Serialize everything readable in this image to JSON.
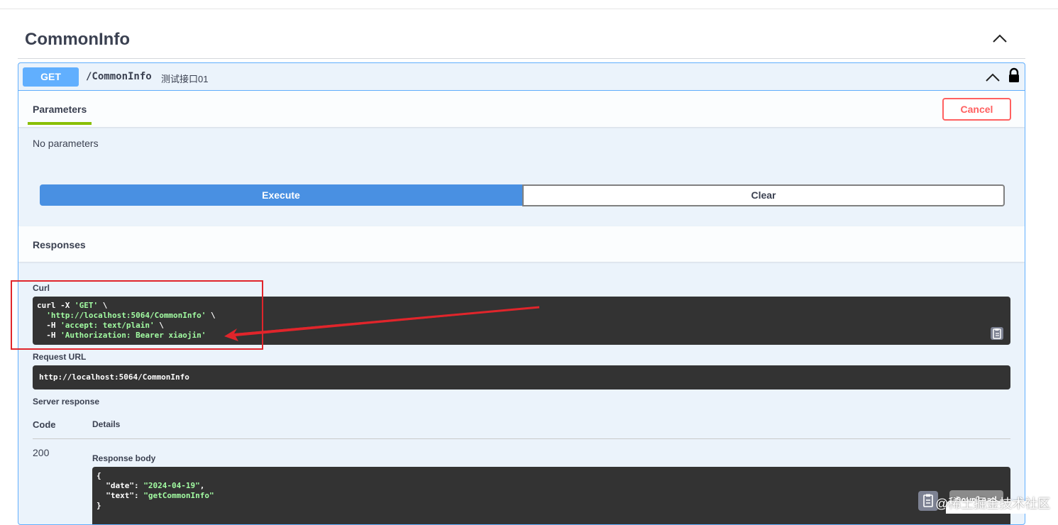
{
  "tag": {
    "title": "CommonInfo"
  },
  "operation": {
    "method": "GET",
    "path": "/CommonInfo",
    "description": "测试接口01"
  },
  "parameters": {
    "tab_label": "Parameters",
    "cancel_label": "Cancel",
    "empty_text": "No parameters"
  },
  "actions": {
    "execute_label": "Execute",
    "clear_label": "Clear"
  },
  "responses": {
    "title": "Responses",
    "curl_label": "Curl",
    "curl_lines": [
      {
        "plain": "curl -X ",
        "green": "'GET'",
        "tail": " \\"
      },
      {
        "plain": "  ",
        "green": "'http://localhost:5064/CommonInfo'",
        "tail": " \\"
      },
      {
        "plain": "  -H ",
        "green": "'accept: text/plain'",
        "tail": " \\"
      },
      {
        "plain": "  -H ",
        "green": "'Authorization: Bearer xiaojin'",
        "tail": ""
      }
    ],
    "request_url_label": "Request URL",
    "request_url": "http://localhost:5064/CommonInfo",
    "server_response_label": "Server response",
    "code_header": "Code",
    "details_header": "Details",
    "status_code": "200",
    "response_body_label": "Response body",
    "body_lines": [
      {
        "plain": "{",
        "key": "",
        "value": "",
        "tail": ""
      },
      {
        "plain": "  ",
        "key": "\"date\"",
        "value": "\"2024-04-19\"",
        "tail": ","
      },
      {
        "plain": "  ",
        "key": "\"text\"",
        "value": "\"getCommonInfo\"",
        "tail": ""
      },
      {
        "plain": "}",
        "key": "",
        "value": "",
        "tail": ""
      }
    ],
    "download_label": "Download"
  },
  "watermark": "@稀土掘金技术社区",
  "colors": {
    "get_accent": "#61affe",
    "execute_blue": "#4990e2",
    "cancel_red": "#ff6060",
    "annotation_red": "#e0252b",
    "code_green": "#a2fca2"
  }
}
